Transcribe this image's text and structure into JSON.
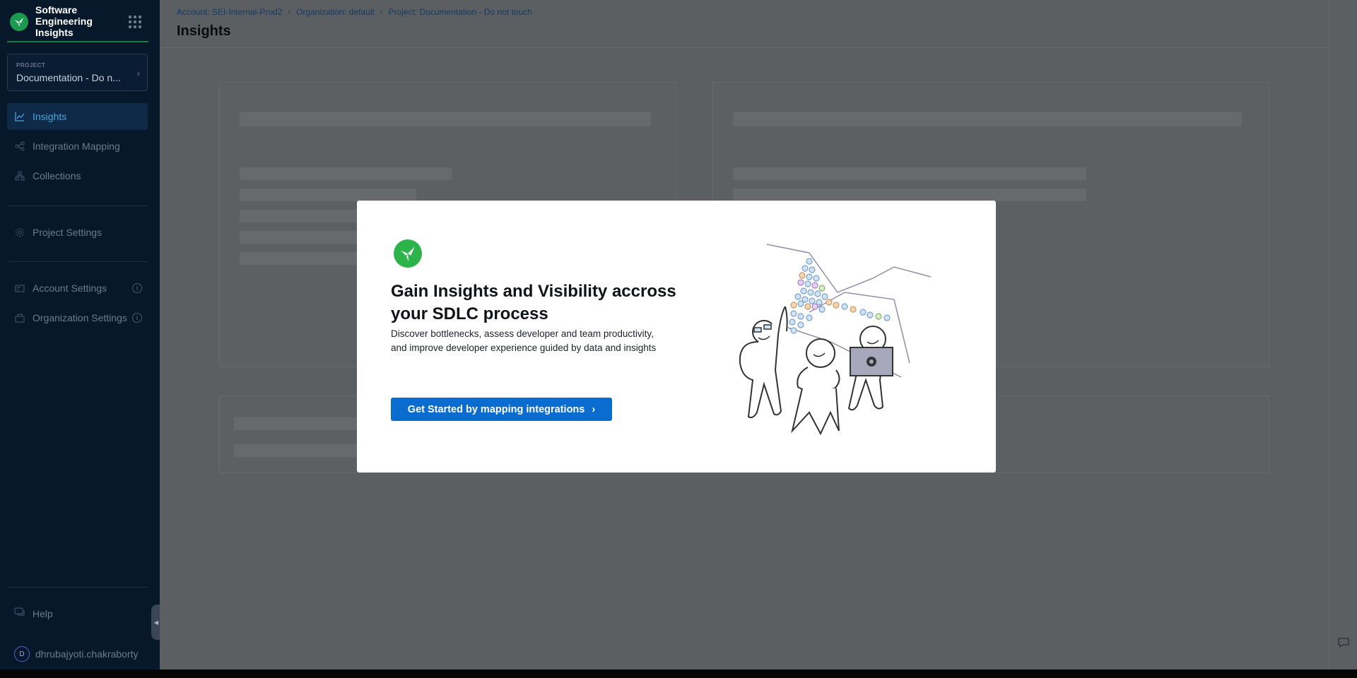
{
  "brand": {
    "title": "Software Engineering Insights"
  },
  "project": {
    "label": "PROJECT",
    "name": "Documentation - Do n..."
  },
  "nav": {
    "items": [
      {
        "label": "Insights",
        "icon": "chart-line-icon",
        "active": true
      },
      {
        "label": "Integration Mapping",
        "icon": "integration-icon",
        "active": false
      },
      {
        "label": "Collections",
        "icon": "collections-icon",
        "active": false
      },
      {
        "label": "Project Settings",
        "icon": "gear-icon",
        "active": false
      },
      {
        "label": "Account Settings",
        "icon": "account-settings-icon",
        "active": false
      },
      {
        "label": "Organization Settings",
        "icon": "organization-icon",
        "active": false
      }
    ],
    "help": "Help",
    "user": {
      "initial": "D",
      "name": "dhrubajyoti.chakraborty"
    }
  },
  "breadcrumb": {
    "account": "Account: SEI-Internal-Prod2",
    "org": "Organization: default",
    "project": "Project: Documentation - Do not touch"
  },
  "page": {
    "title": "Insights"
  },
  "modal": {
    "title": "Gain Insights and Visibility accross your SDLC process",
    "desc_line1": "Discover bottlenecks, assess developer and team productivity,",
    "desc_line2": "and improve developer experience guided by data and insights",
    "cta": "Get Started by mapping integrations"
  },
  "colors": {
    "sidebar_bg": "#07182b",
    "overlay_bg": "#5c5f62",
    "accent_blue": "#0b6ccf",
    "brand_green": "#2cb34a",
    "active_nav": "#4aa3e0"
  }
}
